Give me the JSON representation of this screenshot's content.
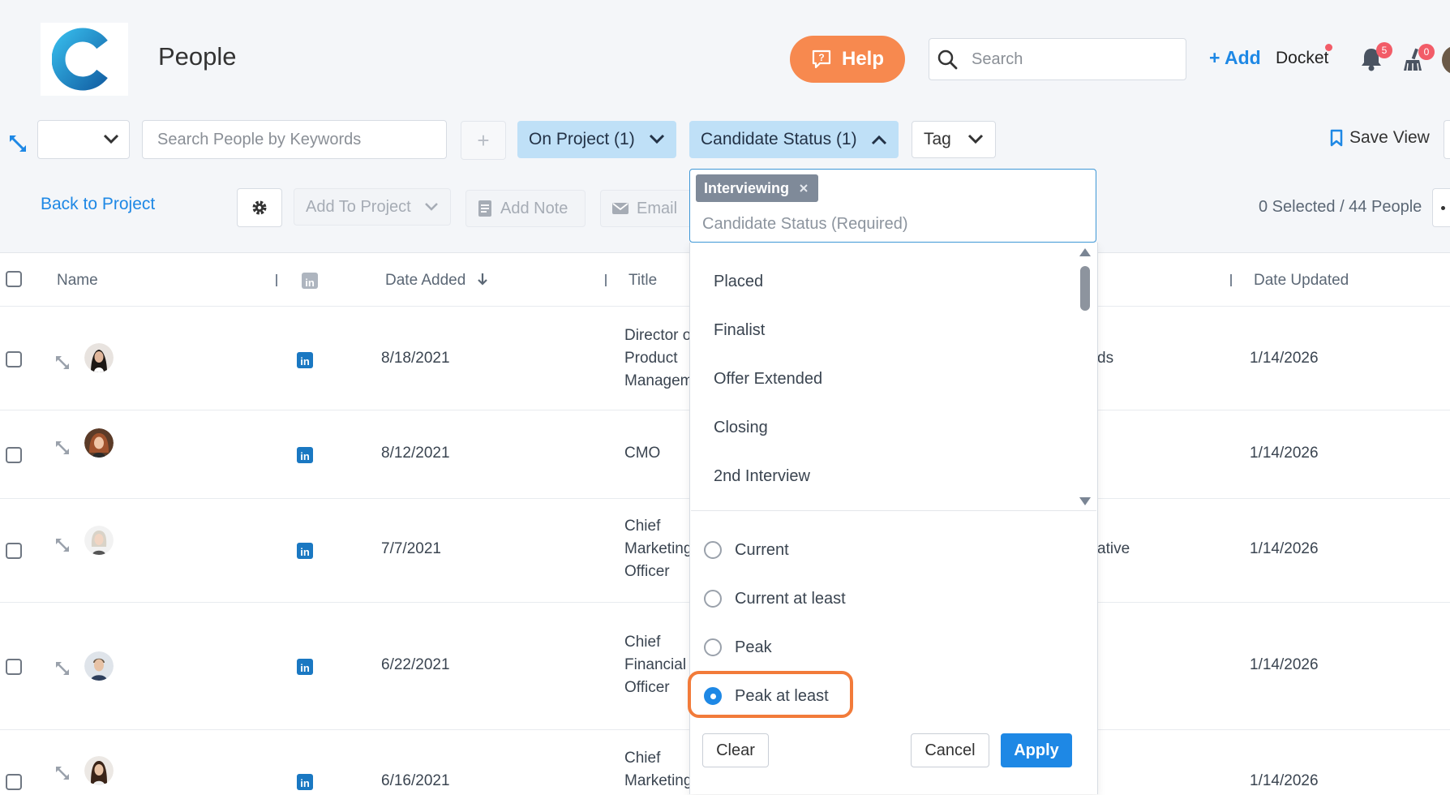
{
  "header": {
    "title": "People",
    "help_label": "Help",
    "search_placeholder": "Search",
    "add_label": "+ Add",
    "docket_label": "Docket",
    "notifications_count": "5",
    "tasks_count": "0"
  },
  "toolbar": {
    "keyword_placeholder": "Search People by Keywords",
    "plus_label": "+",
    "on_project_label": "On Project (1)",
    "candidate_status_label": "Candidate Status (1)",
    "tag_label": "Tag",
    "save_view_label": "Save View"
  },
  "actions": {
    "back_label": "Back to Project",
    "add_to_project_label": "Add To Project",
    "add_note_label": "Add Note",
    "email_label": "Email",
    "selection_summary": "0 Selected / 44 People"
  },
  "table": {
    "headers": {
      "name": "Name",
      "date_added": "Date Added",
      "title": "Title",
      "date_updated": "Date Updated"
    },
    "rows": [
      {
        "date_added": "8/18/2021",
        "title": "Director of Product Management",
        "title_lines": [
          "Director o",
          "Product",
          "Managem"
        ],
        "partial": "ds",
        "date_updated": "1/14/2026"
      },
      {
        "date_added": "8/12/2021",
        "title": "CMO",
        "title_lines": [
          "CMO"
        ],
        "partial": "",
        "date_updated": "1/14/2026"
      },
      {
        "date_added": "7/7/2021",
        "title": "Chief Marketing Officer",
        "title_lines": [
          "Chief",
          "Marketing",
          "Officer"
        ],
        "partial": "ative",
        "date_updated": "1/14/2026"
      },
      {
        "date_added": "6/22/2021",
        "title": "Chief Financial Officer",
        "title_lines": [
          "Chief",
          "Financial",
          "Officer"
        ],
        "partial": "",
        "date_updated": "1/14/2026"
      },
      {
        "date_added": "6/16/2021",
        "title": "Chief Marketing",
        "title_lines": [
          "Chief",
          "Marketing"
        ],
        "partial": "",
        "date_updated": "1/14/2026"
      }
    ]
  },
  "dropdown": {
    "selected_tag": "Interviewing",
    "placeholder": "Candidate Status (Required)",
    "options": [
      "Placed",
      "Finalist",
      "Offer Extended",
      "Closing",
      "2nd Interview"
    ],
    "modes": [
      "Current",
      "Current at least",
      "Peak",
      "Peak at least"
    ],
    "selected_mode": "Peak at least",
    "clear_label": "Clear",
    "cancel_label": "Cancel",
    "apply_label": "Apply"
  },
  "colors": {
    "accent": "#1e88e5",
    "help": "#f7894f",
    "chip_blue": "#bfe0f7",
    "highlight": "#f27b3a",
    "badge": "#f25c68"
  }
}
